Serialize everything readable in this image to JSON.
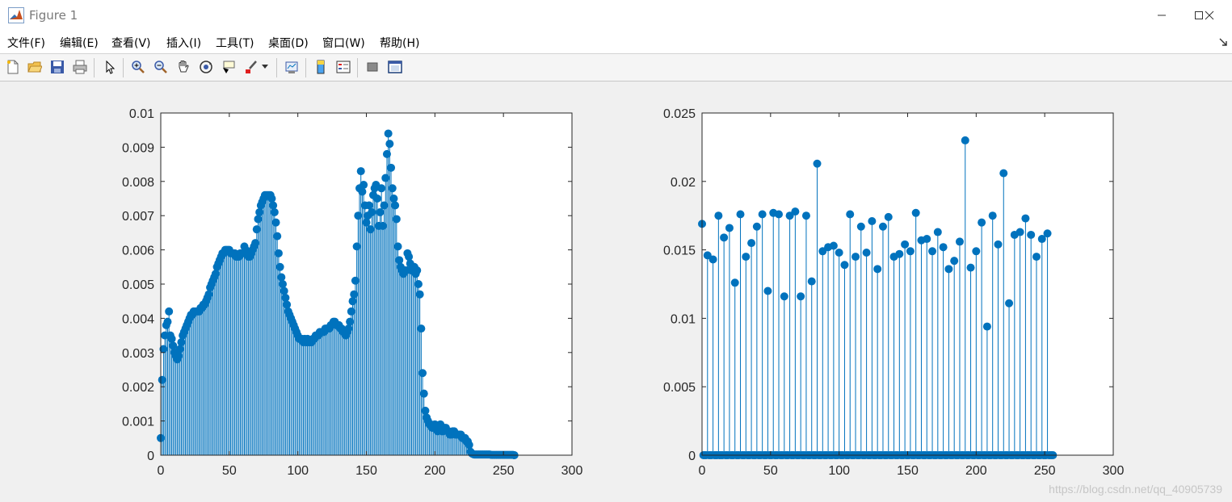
{
  "window": {
    "title": "Figure 1"
  },
  "menu": [
    "文件(F)",
    "编辑(E)",
    "查看(V)",
    "插入(I)",
    "工具(T)",
    "桌面(D)",
    "窗口(W)",
    "帮助(H)"
  ],
  "toolbar_icons": [
    "new-figure-icon",
    "open-file-icon",
    "save-icon",
    "print-icon",
    "select-arrow-icon",
    "zoom-in-icon",
    "zoom-out-icon",
    "pan-hand-icon",
    "rotate-3d-icon",
    "data-cursor-icon",
    "brush-icon",
    "brush-dropdown-icon",
    "link-plot-icon",
    "colorbar-icon",
    "legend-icon",
    "hide-plot-tools-icon",
    "show-plot-tools-icon"
  ],
  "colors": {
    "stem": "#0072bd",
    "axes_bg": "#ffffff",
    "figure_bg": "#f0f0f0"
  },
  "watermark": "https://blog.csdn.net/qq_40905739",
  "chart_data": [
    {
      "type": "stem",
      "xlim": [
        0,
        300
      ],
      "ylim": [
        0,
        0.01
      ],
      "xticks": [
        "0",
        "50",
        "100",
        "150",
        "200",
        "250",
        "300"
      ],
      "yticks": [
        "0",
        "0.001",
        "0.002",
        "0.003",
        "0.004",
        "0.005",
        "0.006",
        "0.007",
        "0.008",
        "0.009",
        "0.01"
      ],
      "x_start": 0,
      "values": [
        0.0005,
        0.0022,
        0.0031,
        0.0035,
        0.0038,
        0.0039,
        0.0042,
        0.0035,
        0.0034,
        0.0032,
        0.003,
        0.0029,
        0.0028,
        0.0029,
        0.0031,
        0.0033,
        0.0035,
        0.0036,
        0.0037,
        0.0038,
        0.0039,
        0.004,
        0.0041,
        0.0041,
        0.0042,
        0.0042,
        0.0042,
        0.0042,
        0.0042,
        0.0043,
        0.0043,
        0.0044,
        0.0044,
        0.0045,
        0.0046,
        0.0047,
        0.0049,
        0.005,
        0.0051,
        0.0052,
        0.0053,
        0.0055,
        0.0056,
        0.0057,
        0.0058,
        0.0059,
        0.0059,
        0.006,
        0.006,
        0.006,
        0.006,
        0.0059,
        0.0059,
        0.0059,
        0.0059,
        0.0058,
        0.0058,
        0.0058,
        0.0059,
        0.0059,
        0.0059,
        0.0061,
        0.006,
        0.0059,
        0.0058,
        0.0058,
        0.0059,
        0.006,
        0.0061,
        0.0062,
        0.0066,
        0.0069,
        0.0071,
        0.0073,
        0.0074,
        0.0075,
        0.0076,
        0.0076,
        0.0076,
        0.0076,
        0.0076,
        0.0075,
        0.0073,
        0.0071,
        0.0068,
        0.0064,
        0.0059,
        0.0055,
        0.0052,
        0.005,
        0.0048,
        0.0046,
        0.0044,
        0.0042,
        0.0041,
        0.004,
        0.0039,
        0.0038,
        0.0037,
        0.0036,
        0.0035,
        0.0034,
        0.0034,
        0.0034,
        0.0033,
        0.0034,
        0.0033,
        0.0034,
        0.0033,
        0.0033,
        0.0033,
        0.0034,
        0.0034,
        0.0035,
        0.0035,
        0.0035,
        0.0036,
        0.0036,
        0.0036,
        0.0036,
        0.0037,
        0.0037,
        0.0037,
        0.0037,
        0.0038,
        0.0038,
        0.0039,
        0.0039,
        0.0038,
        0.0038,
        0.0038,
        0.0037,
        0.0037,
        0.0036,
        0.0036,
        0.0035,
        0.0036,
        0.0037,
        0.0039,
        0.0042,
        0.0045,
        0.0047,
        0.0051,
        0.0061,
        0.007,
        0.0078,
        0.0083,
        0.0077,
        0.0079,
        0.0073,
        0.0068,
        0.007,
        0.0073,
        0.0066,
        0.0071,
        0.0076,
        0.0078,
        0.0079,
        0.0075,
        0.0067,
        0.0071,
        0.0078,
        0.0067,
        0.0073,
        0.0081,
        0.0088,
        0.0094,
        0.0091,
        0.0084,
        0.0078,
        0.0075,
        0.0073,
        0.0069,
        0.0061,
        0.0057,
        0.0055,
        0.0054,
        0.0053,
        0.0054,
        0.0054,
        0.0059,
        0.0058,
        0.0056,
        0.0054,
        0.0054,
        0.0055,
        0.0053,
        0.0054,
        0.005,
        0.0047,
        0.0037,
        0.0024,
        0.0018,
        0.0013,
        0.0011,
        0.001,
        0.0009,
        0.0009,
        0.0008,
        0.0008,
        0.0009,
        0.0008,
        0.0007,
        0.0008,
        0.0009,
        0.0007,
        0.0007,
        0.0008,
        0.0008,
        0.0007,
        0.0007,
        0.0006,
        0.0006,
        0.0007,
        0.0007,
        0.0006,
        0.0006,
        0.0006,
        0.0006,
        0.0006,
        0.0005,
        0.0005,
        0.0005,
        0.0004,
        0.0004,
        0.0003,
        0.0001,
        5e-05,
        3e-05,
        2e-05,
        2e-05,
        2e-05,
        2e-05,
        2e-05,
        2e-05,
        2e-05,
        2e-05,
        2e-05,
        2e-05,
        2e-05,
        2e-05,
        1e-05,
        1e-05,
        1e-05,
        1e-05,
        1e-05,
        1e-05,
        1e-05,
        1e-05,
        1e-05,
        1e-05,
        1e-05,
        1e-05,
        1e-05,
        1e-05,
        1e-05,
        1e-05,
        1e-05,
        0.0
      ]
    },
    {
      "type": "stem",
      "xlim": [
        0,
        300
      ],
      "ylim": [
        0,
        0.025
      ],
      "xticks": [
        "0",
        "50",
        "100",
        "150",
        "200",
        "250",
        "300"
      ],
      "yticks": [
        "0",
        "0.005",
        "0.01",
        "0.015",
        "0.02",
        "0.025"
      ],
      "x_start": 0,
      "x_end": 255,
      "nonzero_x": [
        0,
        4,
        8,
        12,
        16,
        20,
        24,
        28,
        32,
        36,
        40,
        44,
        48,
        52,
        56,
        60,
        64,
        68,
        72,
        76,
        80,
        84,
        88,
        92,
        96,
        100,
        104,
        108,
        112,
        116,
        120,
        124,
        128,
        132,
        136,
        140,
        144,
        148,
        152,
        156,
        160,
        164,
        168,
        172,
        176,
        180,
        184,
        188,
        192,
        196,
        200,
        204,
        208,
        212,
        216,
        220,
        224,
        228,
        232,
        236,
        240,
        244,
        248,
        252,
        256
      ],
      "nonzero_values": [
        0.0169,
        0.0146,
        0.0143,
        0.0175,
        0.0159,
        0.0166,
        0.0126,
        0.0176,
        0.0145,
        0.0155,
        0.0167,
        0.0176,
        0.012,
        0.0177,
        0.0176,
        0.0116,
        0.0175,
        0.0178,
        0.0116,
        0.0175,
        0.0127,
        0.0213,
        0.0149,
        0.0152,
        0.0153,
        0.0148,
        0.0139,
        0.0176,
        0.0145,
        0.0167,
        0.0148,
        0.0171,
        0.0136,
        0.0167,
        0.0174,
        0.0145,
        0.0147,
        0.0154,
        0.0149,
        0.0177,
        0.0157,
        0.0158,
        0.0149,
        0.0163,
        0.0152,
        0.0136,
        0.0142,
        0.0156,
        0.023,
        0.0137,
        0.0149,
        0.017,
        0.0094,
        0.0175,
        0.0154,
        0.0206,
        0.0111,
        0.0161,
        0.0163,
        0.0173,
        0.0161,
        0.0145,
        0.0158,
        0.0162,
        0.0
      ]
    }
  ]
}
